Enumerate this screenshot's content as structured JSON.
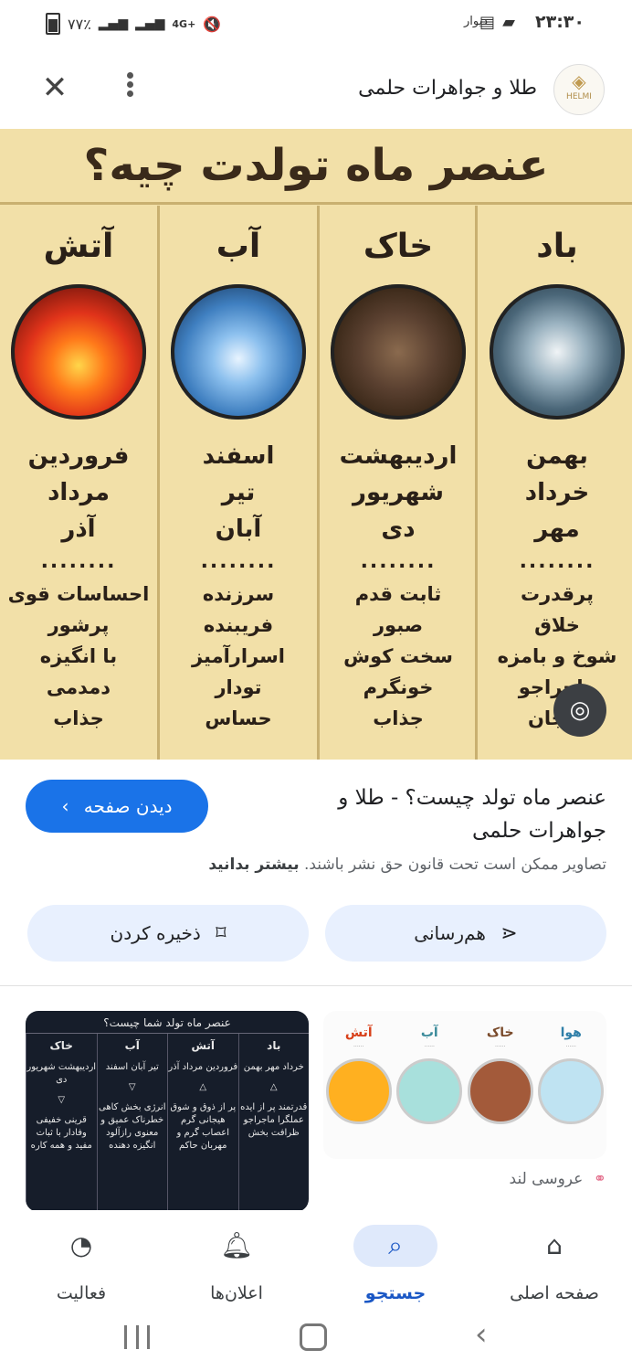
{
  "status": {
    "time": "۲۳:۳۰",
    "carrier": "دیوار",
    "battery": "۷۷٪",
    "network": "4G+"
  },
  "header": {
    "title": "طلا و جواهرات حلمی",
    "logo_text": "HELMI"
  },
  "infographic": {
    "title": "عنصر ماه تولدت چیه؟",
    "columns": [
      {
        "name": "باد",
        "months": [
          "بهمن",
          "خرداد",
          "مهر"
        ],
        "traits": [
          "پرقدرت",
          "خلاق",
          "شوخ و بامزه",
          "ماجراجو",
          "هیجان"
        ],
        "colors": [
          "#f0f4f6",
          "#6a8594",
          "#1c2a33"
        ]
      },
      {
        "name": "خاک",
        "months": [
          "اردیبهشت",
          "شهریور",
          "دی"
        ],
        "traits": [
          "ثابت قدم",
          "صبور",
          "سخت کوش",
          "خونگرم",
          "جذاب"
        ],
        "colors": [
          "#8a6a4e",
          "#4a3322",
          "#1e140c"
        ]
      },
      {
        "name": "آب",
        "months": [
          "اسفند",
          "تیر",
          "آبان"
        ],
        "traits": [
          "سرزنده",
          "فریبنده",
          "اسرارآمیز",
          "تودار",
          "حساس"
        ],
        "colors": [
          "#e8f4ff",
          "#3f7fc0",
          "#0c1f3a"
        ]
      },
      {
        "name": "آتش",
        "months": [
          "فروردین",
          "مرداد",
          "آذر"
        ],
        "traits": [
          "احساسات قوی",
          "پرشور",
          "با انگیزه",
          "دمدمی",
          "جذاب"
        ],
        "colors": [
          "#ffd64a",
          "#e0331a",
          "#3a0505"
        ]
      }
    ],
    "dots": "........"
  },
  "result": {
    "title": "عنصر ماه تولد چیست؟ - طلا و جواهرات حلمی",
    "visit_label": "دیدن صفحه",
    "copyright": "تصاویر ممکن است تحت قانون حق نشر باشند.",
    "learn_more": "بیشتر بدانید",
    "share_label": "هم‌رسانی",
    "save_label": "ذخیره کردن"
  },
  "thumb_left": {
    "title": "عنصر ماه تولد شما چیست؟",
    "columns": [
      {
        "name": "باد",
        "months": "خرداد مهر بهمن",
        "traits": "قدرتمند پر از ایده عملگرا ماجراجو ظرافت بخش"
      },
      {
        "name": "آتش",
        "months": "فروردین مرداد آذر",
        "traits": "پر از ذوق و شوق هیجانی گرم اعصاب گرم و مهربان حاکم"
      },
      {
        "name": "آب",
        "months": "تیر آبان اسفند",
        "traits": "انرژی بخش کاهی خطرناک عمیق و معنوی رازآلود انگیزه دهنده"
      },
      {
        "name": "خاک",
        "months": "اردیبهشت شهریور دی",
        "traits": "قرینی خفیفی وفادار با ثبات مفید و همه کاره"
      }
    ]
  },
  "thumb_right": {
    "columns": [
      {
        "name": "هوا",
        "color": "#2f7fa8",
        "circle": "#bfe3f2"
      },
      {
        "name": "خاک",
        "color": "#7a4a2a",
        "circle": "#a35a3a"
      },
      {
        "name": "آب",
        "color": "#3a8a9a",
        "circle": "#a8e0dc"
      },
      {
        "name": "آتش",
        "color": "#d8401a",
        "circle": "#ffb020"
      }
    ]
  },
  "source": {
    "name": "عروسی لند"
  },
  "bottom_nav": [
    {
      "label": "صفحه اصلی",
      "icon": "home-icon"
    },
    {
      "label": "جستجو",
      "icon": "search-icon"
    },
    {
      "label": "اعلان‌ها",
      "icon": "bell-icon"
    },
    {
      "label": "فعالیت",
      "icon": "activity-icon"
    }
  ]
}
